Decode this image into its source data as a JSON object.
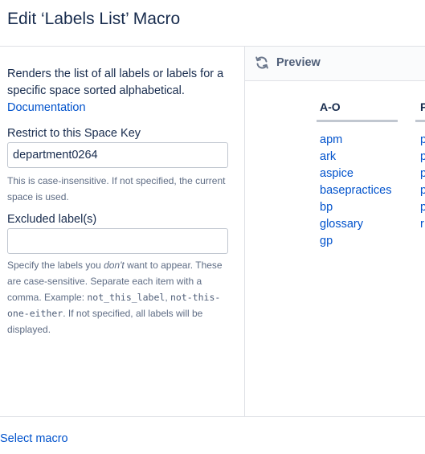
{
  "dialog": {
    "title": "Edit ‘Labels List’ Macro"
  },
  "macro_form": {
    "description": "Renders the list of all labels or labels for a specific space sorted alphabetical.",
    "documentation_link": "Documentation",
    "space_key": {
      "label": "Restrict to this Space Key",
      "value": "department0264",
      "help": "This is case-insensitive. If not specified, the current space is used."
    },
    "excluded_labels": {
      "label": "Excluded label(s)",
      "value": "",
      "help_part1": "Specify the labels you ",
      "help_emphasis": "don't",
      "help_part2": " want to appear. These are case-sensitive. Separate each item with a comma. Example: ",
      "help_code1": "not_this_label",
      "help_sep": ", ",
      "help_code2": "not-this-one-either",
      "help_part3": ". If not specified, all labels will be displayed."
    }
  },
  "preview": {
    "title": "Preview",
    "refresh_icon": "refresh-icon",
    "columns": [
      {
        "heading": "A-O",
        "labels": [
          "apm",
          "ark",
          "aspice",
          "basepractices",
          "bp",
          "glossary",
          "gp"
        ]
      },
      {
        "heading": "P",
        "labels": [
          "p",
          "p",
          "p",
          "p",
          "p",
          "r"
        ]
      }
    ]
  },
  "footer": {
    "select_macro_link": "Select macro"
  },
  "colors": {
    "link": "#0052cc",
    "text": "#172b4d",
    "muted": "#5e6c84",
    "border": "#dfe1e6"
  }
}
